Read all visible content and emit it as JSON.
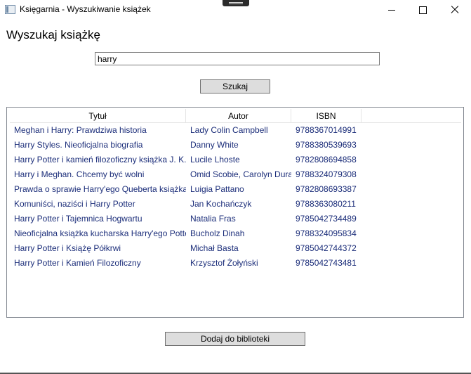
{
  "window": {
    "title": "Księgarnia - Wyszukiwanie książek",
    "controls": {
      "minimize": "minimize-icon",
      "maximize": "maximize-icon",
      "close": "close-icon"
    }
  },
  "heading": "Wyszukaj książkę",
  "search": {
    "value": "harry",
    "button_label": "Szukaj"
  },
  "table": {
    "columns": [
      "Tytuł",
      "Autor",
      "ISBN"
    ],
    "rows": [
      {
        "title": "Meghan i Harry: Prawdziwa historia",
        "author": "Lady Colin Campbell",
        "isbn": "9788367014991"
      },
      {
        "title": "Harry Styles. Nieoficjalna biografia",
        "author": "Danny White",
        "isbn": "9788380539693"
      },
      {
        "title": "Harry Potter i kamień filozoficzny książka J. K. Rowling",
        "author": "Lucile Lhoste",
        "isbn": "9782808694858"
      },
      {
        "title": "Harry i Meghan. Chcemy być wolni",
        "author": "Omid Scobie, Carolyn Durand",
        "isbn": "9788324079308"
      },
      {
        "title": "Prawda o sprawie Harry'ego Queberta książka",
        "author": "Luigia Pattano",
        "isbn": "9782808693387"
      },
      {
        "title": "Komuniści, naziści i Harry Potter",
        "author": "Jan Kochańczyk",
        "isbn": "9788363080211"
      },
      {
        "title": "Harry Potter i Tajemnica Hogwartu",
        "author": "Natalia Fras",
        "isbn": "9785042734489"
      },
      {
        "title": "Nieoficjalna książka kucharska Harry'ego Pottera",
        "author": "Bucholz Dinah",
        "isbn": "9788324095834"
      },
      {
        "title": "Harry Potter i Książę Półkrwi",
        "author": "Michał Basta",
        "isbn": "9785042744372"
      },
      {
        "title": "Harry Potter i Kamień Filozoficzny",
        "author": "Krzysztof Żołyński",
        "isbn": "9785042743481"
      }
    ]
  },
  "add_button_label": "Dodaj do biblioteki",
  "colors": {
    "row_text": "#1c2e7a",
    "button_bg": "#dddddd",
    "button_border": "#707070"
  }
}
